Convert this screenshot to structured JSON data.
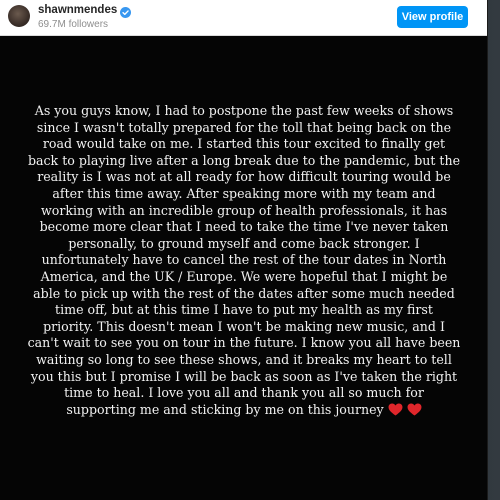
{
  "header": {
    "username": "shawnmendes",
    "followers": "69.7M followers",
    "view_profile_label": "View profile"
  },
  "story": {
    "lines": [
      "As you guys know, I had to postpone the past few weeks of shows",
      "since I wasn't totally prepared for the toll that being back on the",
      "road would take on me. I started this tour excited to finally get",
      "back to playing live after a long break due to the pandemic, but the",
      "reality is I was not at all ready for how difficult touring would be",
      "after this time away. After speaking more with my team and",
      "working with an incredible group of health professionals, it has",
      "become more clear that I need to take the time I've never taken",
      "personally, to ground myself and come back stronger. I",
      "unfortunately have to cancel the rest of the tour dates in North",
      "America, and the UK / Europe. We were hopeful that I might be",
      "able to pick up with the rest of the dates after some much needed",
      "time off, but at this time I have to put my health as my first",
      "priority. This doesn't mean I won't be making new music, and I",
      "can't wait to see you on tour in the future. I know you all have been",
      "waiting so long to see these shows, and it breaks my heart to tell",
      "you this but I promise I will be back as soon as I've taken the right",
      "time to heal. I love you all and thank you all so much for",
      "supporting me and sticking by me on this journey"
    ]
  },
  "colors": {
    "accent": "#0095f6",
    "heart": "#e0262b",
    "text": "#f2f2f2",
    "background": "#050505"
  },
  "icons": [
    "verified-badge-icon",
    "heart-emoji-icon",
    "heart-emoji-icon"
  ]
}
